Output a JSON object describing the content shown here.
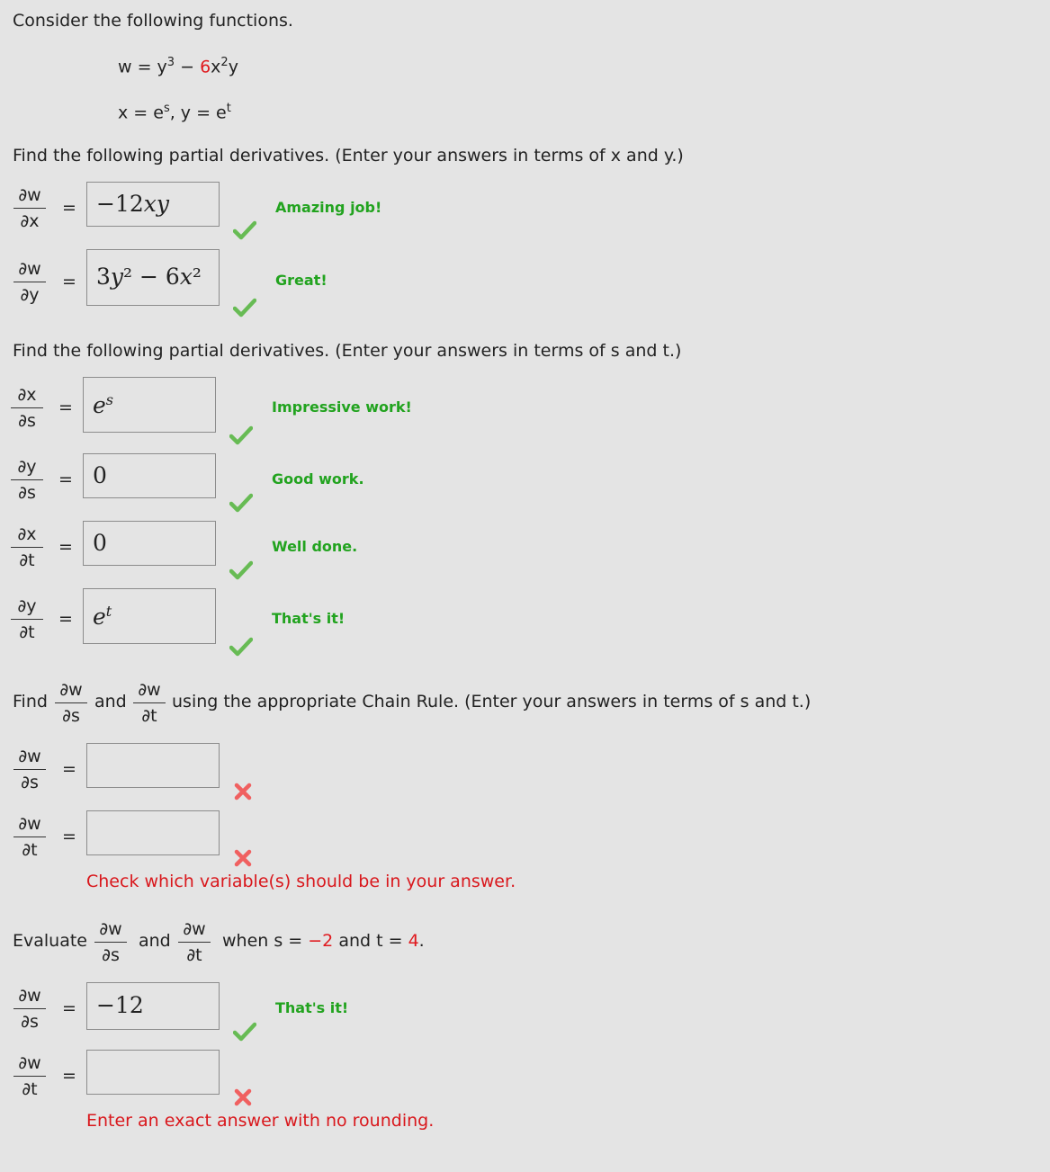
{
  "intro": "Consider the following functions.",
  "functions": {
    "w_prefix": "w = y",
    "w_exp": "3",
    "w_minus": " − ",
    "w_red": "6",
    "w_rest": "x",
    "w_rest_exp": "2",
    "w_end": "y",
    "xy_line": "x = e",
    "xy_s": "s",
    "xy_mid": ",  y = e",
    "xy_t": "t"
  },
  "section1": {
    "prompt": "Find the following partial derivatives. (Enter your answers in terms of x and y.)",
    "items": [
      {
        "num": "∂w",
        "den": "∂x",
        "answer": "−12xy",
        "feedback": "Amazing job!",
        "status": "correct"
      },
      {
        "num": "∂w",
        "den": "∂y",
        "answer": "3y² − 6x²",
        "feedback": "Great!",
        "status": "correct"
      }
    ]
  },
  "section2": {
    "prompt": "Find the following partial derivatives. (Enter your answers in terms of s and t.)",
    "items": [
      {
        "num": "∂x",
        "den": "∂s",
        "answer": "e^s",
        "feedback": "Impressive work!",
        "status": "correct"
      },
      {
        "num": "∂y",
        "den": "∂s",
        "answer": "0",
        "feedback": "Good work.",
        "status": "correct"
      },
      {
        "num": "∂x",
        "den": "∂t",
        "answer": "0",
        "feedback": "Well done.",
        "status": "correct"
      },
      {
        "num": "∂y",
        "den": "∂t",
        "answer": "e^t",
        "feedback": "That's it!",
        "status": "correct"
      }
    ]
  },
  "section3": {
    "find": "Find",
    "and": "and",
    "rest": "using the appropriate Chain Rule. (Enter your answers in terms of s and t.)",
    "f1_num": "∂w",
    "f1_den": "∂s",
    "f2_num": "∂w",
    "f2_den": "∂t",
    "items": [
      {
        "num": "∂w",
        "den": "∂s",
        "answer": "",
        "status": "incorrect"
      },
      {
        "num": "∂w",
        "den": "∂t",
        "answer": "",
        "status": "incorrect"
      }
    ],
    "error": "Check which variable(s) should be in your answer."
  },
  "section4": {
    "evaluate": "Evaluate",
    "and": "and",
    "when": "when s = ",
    "s_val": "−2",
    "and2": " and t = ",
    "t_val": "4",
    "period": ".",
    "f1_num": "∂w",
    "f1_den": "∂s",
    "f2_num": "∂w",
    "f2_den": "∂t",
    "items": [
      {
        "num": "∂w",
        "den": "∂s",
        "answer": "−12",
        "feedback": "That's it!",
        "status": "correct"
      },
      {
        "num": "∂w",
        "den": "∂t",
        "answer": "",
        "status": "incorrect"
      }
    ],
    "error": "Enter an exact answer with no rounding."
  },
  "equals": "=",
  "colors": {
    "correct": "#22a31f",
    "error": "#e0191e",
    "check": "#5cb85c",
    "cross": "#f26a6a"
  }
}
